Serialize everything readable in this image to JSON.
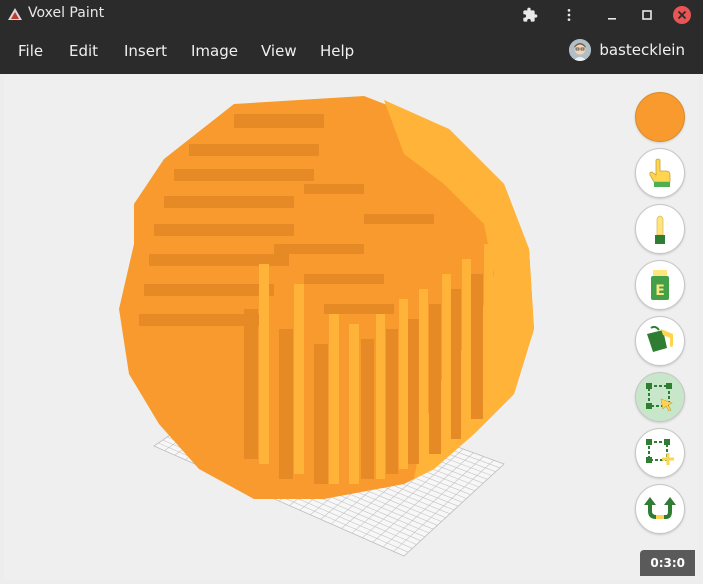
{
  "titlebar": {
    "title": "Voxel Paint",
    "icons": [
      "voxel-app-icon",
      "extension-icon",
      "more-vert-icon",
      "minimize-icon",
      "maximize-icon",
      "close-icon"
    ]
  },
  "menu": {
    "items": [
      {
        "label": "File"
      },
      {
        "label": "Edit"
      },
      {
        "label": "Insert"
      },
      {
        "label": "Image"
      },
      {
        "label": "View"
      },
      {
        "label": "Help"
      }
    ]
  },
  "user": {
    "name": "bastecklein"
  },
  "tools": [
    {
      "name": "current-color",
      "icon": "color-swatch",
      "color": "#F89A2E"
    },
    {
      "name": "pointer-tool",
      "icon": "pointing-hand-icon"
    },
    {
      "name": "paint-tool",
      "icon": "paint-stick-icon"
    },
    {
      "name": "eraser-tool",
      "icon": "eraser-icon"
    },
    {
      "name": "fill-tool",
      "icon": "paint-bucket-icon"
    },
    {
      "name": "select-tool",
      "icon": "selection-icon",
      "active": true
    },
    {
      "name": "move-selection-tool",
      "icon": "move-selection-icon"
    },
    {
      "name": "rotate-tool",
      "icon": "rotate-arrow-icon"
    }
  ],
  "status": {
    "text": "0:3:0"
  },
  "colors": {
    "voxel_light": "#FFB338",
    "voxel_main": "#F89A2E",
    "voxel_dark": "#E58A24",
    "chrome": "#2B2B2B"
  }
}
